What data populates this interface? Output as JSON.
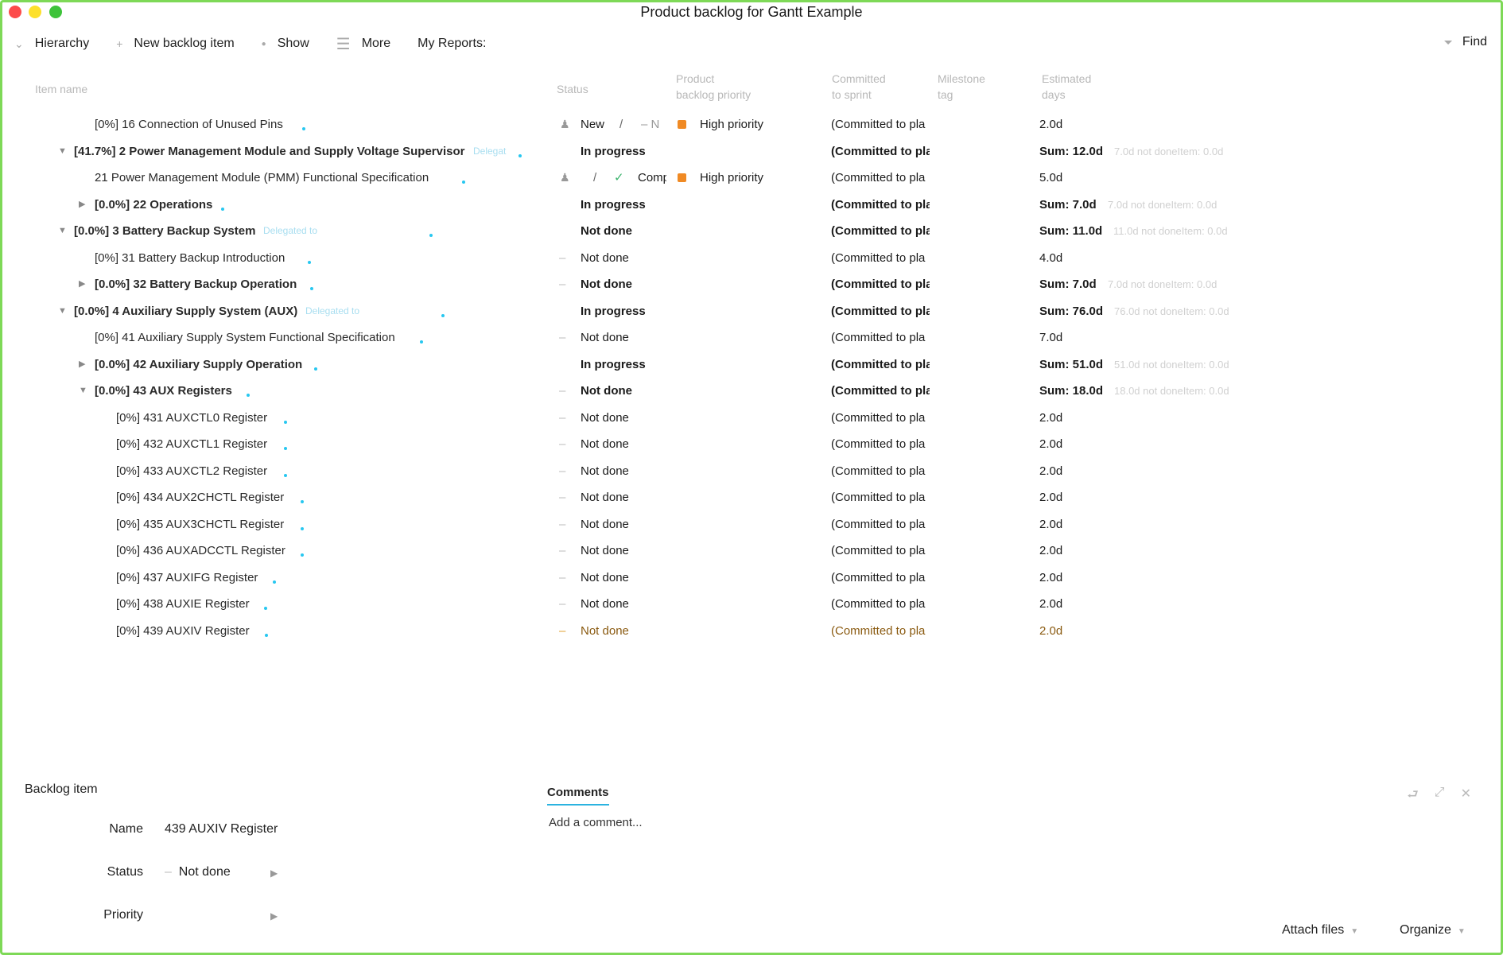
{
  "window": {
    "title": "Product backlog for Gantt Example"
  },
  "toolbar": {
    "hierarchy": "Hierarchy",
    "new_item": "New backlog item",
    "show": "Show",
    "more": "More",
    "reports": "My Reports:",
    "find": "Find"
  },
  "columns": {
    "name": "Item name",
    "status": "Status",
    "priority_1": "Product",
    "priority_2": "backlog priority",
    "sprint_1": "Committed",
    "sprint_2": "to sprint",
    "milestone_1": "Milestone",
    "milestone_2": "tag",
    "est_1": "Estimated",
    "est_2": "days"
  },
  "rows": [
    {
      "name": "[0%] 16 Connection of Unused Pins",
      "status": "New",
      "status_extra": "/",
      "status_extra2": "–  N",
      "priority": "High priority",
      "commit": "(Committed to pla",
      "est": "2.0d"
    },
    {
      "name": "[41.7%] 2 Power Management Module and Supply Voltage Supervisor",
      "deleg": "Delegat",
      "status": "In progress",
      "commit": "(Committed to pla",
      "est": "Sum: 12.0d",
      "note": "7.0d not doneItem: 0.0d"
    },
    {
      "name": "21 Power Management Module (PMM) Functional Specification",
      "status_extra": "/",
      "status": "Comp",
      "priority": "High priority",
      "commit": "(Committed to pla",
      "est": "5.0d"
    },
    {
      "name": "[0.0%] 22 Operations",
      "status": "In progress",
      "commit": "(Committed to pla",
      "est": "Sum: 7.0d",
      "note": "7.0d not doneItem: 0.0d"
    },
    {
      "name": "[0.0%] 3 Battery Backup System",
      "deleg": "Delegated to",
      "status": "Not done",
      "commit": "(Committed to pla",
      "est": "Sum: 11.0d",
      "note": "11.0d not doneItem: 0.0d"
    },
    {
      "name": "[0%] 31 Battery Backup Introduction",
      "status": "Not done",
      "commit": "(Committed to pla",
      "est": "4.0d"
    },
    {
      "name": "[0.0%] 32 Battery Backup Operation",
      "status": "Not done",
      "commit": "(Committed to pla",
      "est": "Sum: 7.0d",
      "note": "7.0d not doneItem: 0.0d"
    },
    {
      "name": "[0.0%] 4 Auxiliary Supply System (AUX)",
      "deleg": "Delegated to",
      "status": "In progress",
      "commit": "(Committed to pla",
      "est": "Sum: 76.0d",
      "note": "76.0d not doneItem: 0.0d"
    },
    {
      "name": "[0%] 41 Auxiliary Supply System Functional Specification",
      "status": "Not done",
      "commit": "(Committed to pla",
      "est": "7.0d"
    },
    {
      "name": "[0.0%] 42 Auxiliary Supply Operation",
      "status": "In progress",
      "commit": "(Committed to pla",
      "est": "Sum: 51.0d",
      "note": "51.0d not doneItem: 0.0d"
    },
    {
      "name": "[0.0%] 43 AUX Registers",
      "status": "Not done",
      "commit": "(Committed to pla",
      "est": "Sum: 18.0d",
      "note": "18.0d not doneItem: 0.0d"
    },
    {
      "name": "[0%] 431 AUXCTL0 Register",
      "status": "Not done",
      "commit": "(Committed to pla",
      "est": "2.0d"
    },
    {
      "name": "[0%] 432 AUXCTL1 Register",
      "status": "Not done",
      "commit": "(Committed to pla",
      "est": "2.0d"
    },
    {
      "name": "[0%] 433 AUXCTL2 Register",
      "status": "Not done",
      "commit": "(Committed to pla",
      "est": "2.0d"
    },
    {
      "name": "[0%] 434 AUX2CHCTL Register",
      "status": "Not done",
      "commit": "(Committed to pla",
      "est": "2.0d"
    },
    {
      "name": "[0%] 435 AUX3CHCTL Register",
      "status": "Not done",
      "commit": "(Committed to pla",
      "est": "2.0d"
    },
    {
      "name": "[0%] 436 AUXADCCTL Register",
      "status": "Not done",
      "commit": "(Committed to pla",
      "est": "2.0d"
    },
    {
      "name": "[0%] 437 AUXIFG Register",
      "status": "Not done",
      "commit": "(Committed to pla",
      "est": "2.0d"
    },
    {
      "name": "[0%] 438 AUXIE Register",
      "status": "Not done",
      "commit": "(Committed to pla",
      "est": "2.0d"
    },
    {
      "name": "[0%] 439 AUXIV Register",
      "status": "Not done",
      "commit": "(Committed to pla",
      "est": "2.0d"
    }
  ],
  "detail": {
    "title": "Backlog item",
    "name_label": "Name",
    "name_value": "439 AUXIV Register",
    "status_label": "Status",
    "status_value": "Not done",
    "priority_label": "Priority"
  },
  "comments": {
    "tab": "Comments",
    "placeholder": "Add a comment..."
  },
  "bottom": {
    "attach": "Attach files",
    "organize": "Organize"
  },
  "colors": {
    "accent": "#2bb3e0",
    "priority_high": "#f08a24",
    "frame": "#7ed957"
  }
}
